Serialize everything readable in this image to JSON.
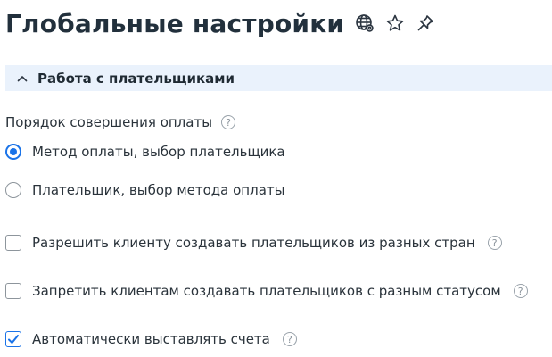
{
  "header": {
    "title": "Глобальные настройки",
    "icons": [
      "globe-settings-icon",
      "star-icon",
      "pin-icon"
    ]
  },
  "section": {
    "title": "Работа с плательщиками",
    "expanded": true
  },
  "payment_order": {
    "label": "Порядок совершения оплаты",
    "help": "?",
    "options": [
      {
        "label": "Метод оплаты, выбор плательщика",
        "selected": true
      },
      {
        "label": "Плательщик, выбор метода оплаты",
        "selected": false
      }
    ]
  },
  "checkboxes": [
    {
      "label": "Разрешить клиенту создавать плательщиков из разных стран",
      "checked": false,
      "help": "?"
    },
    {
      "label": "Запретить клиентам создавать плательщиков с разным статусом",
      "checked": false,
      "help": "?"
    },
    {
      "label": "Автоматически выставлять счета",
      "checked": true,
      "help": "?"
    }
  ],
  "colors": {
    "accent": "#1a73e8",
    "section_bg": "#eaf2fc",
    "title": "#22303c"
  }
}
